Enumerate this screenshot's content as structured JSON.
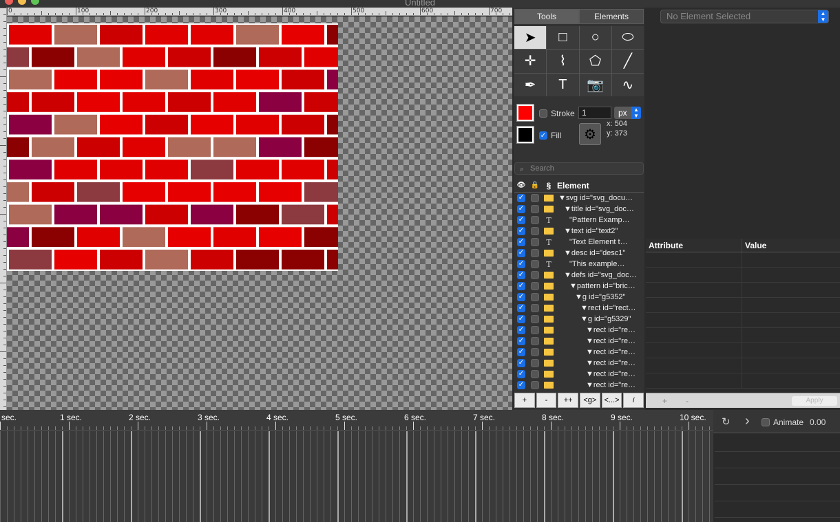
{
  "window": {
    "title": "Untitled"
  },
  "ruler": {
    "ticks": [
      "0",
      "100",
      "200",
      "300",
      "400",
      "500",
      "600",
      "700"
    ]
  },
  "tabs": [
    {
      "label": "Tools",
      "selected": true
    },
    {
      "label": "Elements",
      "selected": false
    }
  ],
  "tools": [
    {
      "name": "select-arrow-tool",
      "glyph": "➤"
    },
    {
      "name": "rectangle-tool",
      "glyph": "□"
    },
    {
      "name": "circle-tool",
      "glyph": "○"
    },
    {
      "name": "ellipse-tool",
      "glyph": "⬭"
    },
    {
      "name": "crosshair-tool",
      "glyph": "✛"
    },
    {
      "name": "polyline-tool",
      "glyph": "⌇"
    },
    {
      "name": "polygon-tool",
      "glyph": "⬠"
    },
    {
      "name": "line-tool",
      "glyph": "╱"
    },
    {
      "name": "pen-tool",
      "glyph": "✒"
    },
    {
      "name": "text-tool",
      "glyph": "T"
    },
    {
      "name": "image-tool",
      "glyph": "📷"
    },
    {
      "name": "path-tool",
      "glyph": "∿"
    }
  ],
  "style": {
    "stroke_label": "Stroke",
    "fill_label": "Fill",
    "stroke_width": "1",
    "unit": "px",
    "stroke_checked": false,
    "fill_checked": true,
    "stroke_color": "#ff0000",
    "fill_color": "#000000"
  },
  "coords": {
    "x": "x: 504",
    "y": "y: 373"
  },
  "search": {
    "placeholder": "Search"
  },
  "tree": {
    "header": {
      "visible_icon": "👁",
      "lock_icon": "🔒",
      "section": "§",
      "element": "Element"
    },
    "rows": [
      {
        "icon": "folder",
        "indent": 0,
        "label": "▼svg id=\"svg_docu…"
      },
      {
        "icon": "folder",
        "indent": 1,
        "label": "▼title id=\"svg_doc…"
      },
      {
        "icon": "text",
        "indent": 2,
        "label": "\"Pattern Examp…"
      },
      {
        "icon": "folder",
        "indent": 1,
        "label": "▼text id=\"text2\""
      },
      {
        "icon": "text",
        "indent": 2,
        "label": "\"Text Element t…"
      },
      {
        "icon": "folder",
        "indent": 1,
        "label": "▼desc id=\"desc1\""
      },
      {
        "icon": "text",
        "indent": 2,
        "label": "\"This example…"
      },
      {
        "icon": "folder",
        "indent": 1,
        "label": "▼defs id=\"svg_doc…"
      },
      {
        "icon": "folder",
        "indent": 2,
        "label": "▼pattern id=\"bric…"
      },
      {
        "icon": "folder",
        "indent": 3,
        "label": "▼g id=\"g5352\""
      },
      {
        "icon": "folder",
        "indent": 4,
        "label": "▼rect id=\"rect…"
      },
      {
        "icon": "folder",
        "indent": 4,
        "label": "▼g id=\"g5329\""
      },
      {
        "icon": "folder",
        "indent": 5,
        "label": "▼rect id=\"re…"
      },
      {
        "icon": "folder",
        "indent": 5,
        "label": "▼rect id=\"re…"
      },
      {
        "icon": "folder",
        "indent": 5,
        "label": "▼rect id=\"re…"
      },
      {
        "icon": "folder",
        "indent": 5,
        "label": "▼rect id=\"re…"
      },
      {
        "icon": "folder",
        "indent": 5,
        "label": "▼rect id=\"re…"
      },
      {
        "icon": "folder",
        "indent": 5,
        "label": "▼rect id=\"re…"
      }
    ],
    "buttons": [
      "+",
      "-",
      "++",
      "<g>",
      "<...>",
      "𝑖"
    ]
  },
  "inspector": {
    "select_value": "No Element Selected",
    "attr_header": "Attribute",
    "value_header": "Value",
    "add_label": "+",
    "remove_label": "-",
    "apply_label": "Apply"
  },
  "timeline": {
    "labels": [
      "sec.",
      "1 sec.",
      "2 sec.",
      "3 sec.",
      "4 sec.",
      "5 sec.",
      "6 sec.",
      "7 sec.",
      "8 sec.",
      "9 sec.",
      "10 sec."
    ],
    "refresh_icon": "↻",
    "play_icon": "›",
    "animate_label": "Animate",
    "animate_checked": false,
    "time_value": "0.00"
  },
  "colors": {
    "brick_palette": [
      "#b06a5a",
      "#cc0000",
      "#8b0040",
      "#e00000",
      "#8b0000",
      "#8c3a40",
      "#e60000"
    ],
    "mortar": "#ffffff",
    "accent": "#1a6ee6"
  }
}
